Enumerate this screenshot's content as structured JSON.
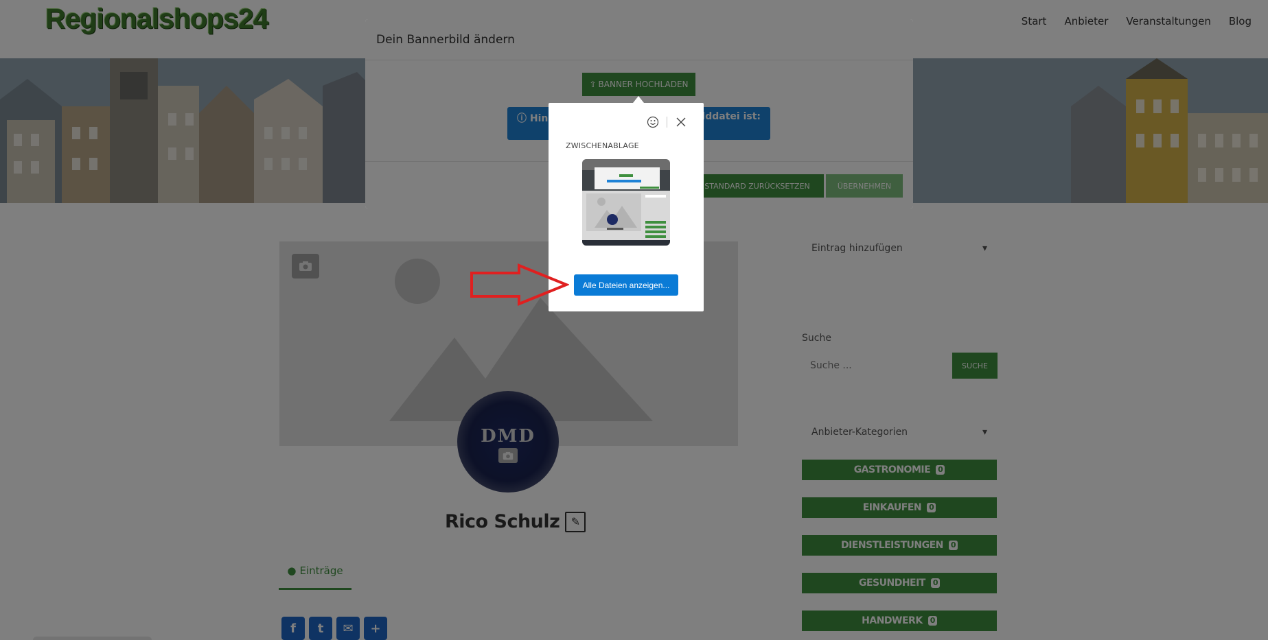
{
  "site": {
    "logo": "Regionalshops24",
    "nav": [
      "Start",
      "Anbieter",
      "Veranstaltungen",
      "Blog"
    ]
  },
  "profile": {
    "avatar_text": "DMD",
    "name": "Rico Schulz",
    "tab_label": "Einträge",
    "share_buttons": [
      "facebook-icon",
      "twitter-icon",
      "email-icon",
      "share-plus-icon"
    ]
  },
  "sidebar": {
    "entry_select": "Eintrag hinzufügen",
    "search_label": "Suche",
    "search_placeholder": "Suche ...",
    "search_button": "SUCHE",
    "category_select": "Anbieter-Kategorien",
    "categories": [
      {
        "label": "GASTRONOMIE",
        "count": "0"
      },
      {
        "label": "EINKAUFEN",
        "count": "0"
      },
      {
        "label": "DIENSTLEISTUNGEN",
        "count": "0"
      },
      {
        "label": "GESUNDHEIT",
        "count": "0"
      },
      {
        "label": "HANDWERK",
        "count": "0"
      }
    ]
  },
  "modal": {
    "title": "Dein Bannerbild ändern",
    "upload_button": "BANNER HOCHLADEN",
    "hint_left": "Hin",
    "hint_right": "Bilddatei ist:",
    "reset_button": "STANDARD ZURÜCKSETZEN",
    "apply_button": "ÜBERNEHMEN"
  },
  "picker": {
    "clipboard_label": "ZWISCHENABLAGE",
    "show_all_button": "Alle Dateien anzeigen..."
  },
  "colors": {
    "green": "#3e8f3e",
    "blue_button": "#0a7bd6",
    "hint_blue": "#1f82d6",
    "annotation_red": "#e02020"
  }
}
